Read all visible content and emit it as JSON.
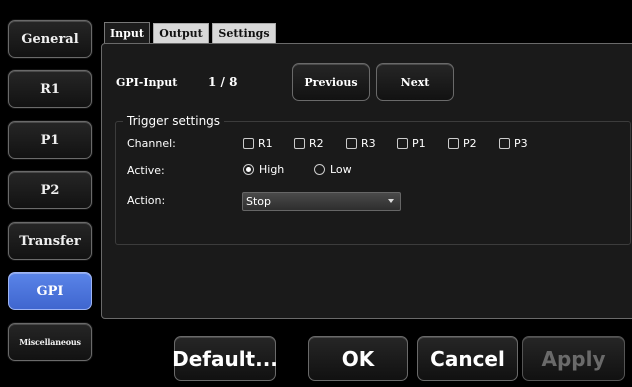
{
  "nav": {
    "items": [
      {
        "label": "General"
      },
      {
        "label": "R1"
      },
      {
        "label": "P1"
      },
      {
        "label": "P2"
      },
      {
        "label": "Transfer"
      },
      {
        "label": "GPI"
      },
      {
        "label": "Miscellaneous"
      }
    ],
    "active": "GPI"
  },
  "tabs": {
    "items": [
      {
        "label": "Input"
      },
      {
        "label": "Output"
      },
      {
        "label": "Settings"
      }
    ],
    "active": "Input"
  },
  "gpi": {
    "title": "GPI-Input",
    "counter": "1 / 8",
    "previous_label": "Previous",
    "next_label": "Next"
  },
  "trigger": {
    "legend": "Trigger settings",
    "channel_label": "Channel:",
    "channels": [
      {
        "label": "R1",
        "checked": false
      },
      {
        "label": "R2",
        "checked": false
      },
      {
        "label": "R3",
        "checked": false
      },
      {
        "label": "P1",
        "checked": false
      },
      {
        "label": "P2",
        "checked": false
      },
      {
        "label": "P3",
        "checked": false
      }
    ],
    "active_label": "Active:",
    "active_options": [
      {
        "label": "High",
        "selected": true
      },
      {
        "label": "Low",
        "selected": false
      }
    ],
    "action_label": "Action:",
    "action_value": "Stop"
  },
  "footer": {
    "default_label": "Default...",
    "ok_label": "OK",
    "cancel_label": "Cancel",
    "apply_label": "Apply"
  },
  "colors": {
    "active_nav": "#4a74de",
    "background": "#000000",
    "panel": "#1a1a1a"
  }
}
